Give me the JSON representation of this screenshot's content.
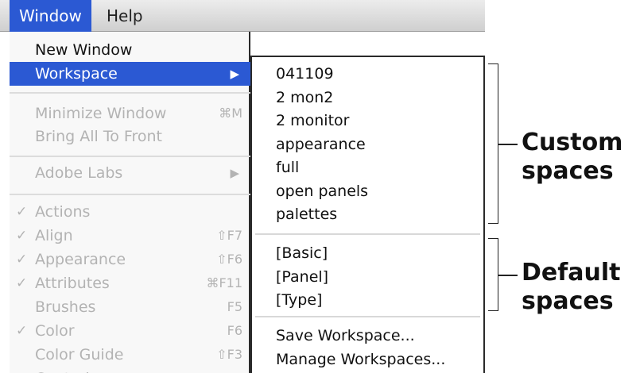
{
  "menubar": {
    "window_label": "Window",
    "help_label": "Help"
  },
  "window_menu": {
    "new_window": "New Window",
    "workspace": "Workspace",
    "minimize_window": "Minimize Window",
    "minimize_shortcut": "⌘M",
    "bring_all_to_front": "Bring All To Front",
    "adobe_labs": "Adobe Labs",
    "panels": [
      {
        "label": "Actions",
        "checked": true,
        "shortcut": ""
      },
      {
        "label": "Align",
        "checked": true,
        "shortcut": "⇧F7"
      },
      {
        "label": "Appearance",
        "checked": true,
        "shortcut": "⇧F6"
      },
      {
        "label": "Attributes",
        "checked": true,
        "shortcut": "⌘F11"
      },
      {
        "label": "Brushes",
        "checked": false,
        "shortcut": "F5"
      },
      {
        "label": "Color",
        "checked": true,
        "shortcut": "F6"
      },
      {
        "label": "Color Guide",
        "checked": false,
        "shortcut": "⇧F3"
      },
      {
        "label": "Control",
        "checked": true,
        "shortcut": ""
      }
    ],
    "check_glyph": "✓",
    "submenu_arrow": "▶"
  },
  "workspace_submenu": {
    "custom": [
      "041109",
      "2 mon2",
      "2 monitor",
      "appearance",
      "full",
      "open panels",
      "palettes"
    ],
    "default": [
      "[Basic]",
      "[Panel]",
      "[Type]"
    ],
    "actions": [
      "Save Workspace...",
      "Manage Workspaces..."
    ]
  },
  "annotations": {
    "custom_line1": "Custom",
    "custom_line2": "spaces",
    "default_line1": "Default",
    "default_line2": "spaces"
  },
  "colors": {
    "selection": "#2b59d3",
    "disabled_text": "#b3b3b3"
  }
}
